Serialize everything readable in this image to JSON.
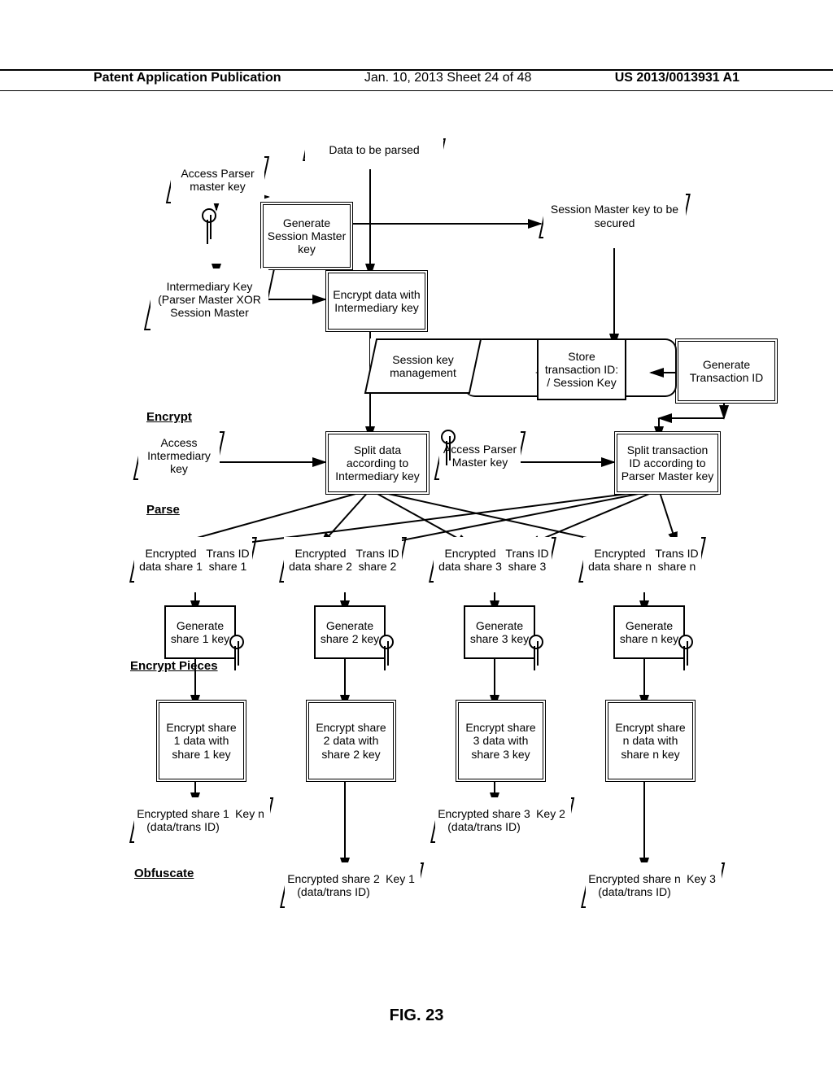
{
  "header": {
    "left": "Patent Application Publication",
    "mid": "Jan. 10, 2013  Sheet 24 of 48",
    "right": "US 2013/0013931 A1"
  },
  "figure_label": "FIG. 23",
  "sections": {
    "encrypt": "Encrypt",
    "parse": "Parse",
    "encrypt_pieces": "Encrypt Pieces",
    "obfuscate": "Obfuscate"
  },
  "nodes": {
    "data_to_be_parsed": "Data to be parsed",
    "access_parser_master_key": "Access Parser master key",
    "generate_session_master_key": "Generate Session Master key",
    "session_master_key_to_be_secured": "Session Master key to be secured",
    "intermediary_key": "Intermediary Key (Parser Master XOR Session Master",
    "encrypt_data_intermediary": "Encrypt data with Intermediary key",
    "session_key_management": "Session key management",
    "store_transaction_id_session_key": "Store transaction ID: / Session Key",
    "generate_transaction_id": "Generate Transaction ID",
    "access_intermediary_key": "Access Intermediary key",
    "split_data_intermediary": "Split data according to Intermediary key",
    "access_parser_master_key2": "Access Parser Master key",
    "split_transaction_id": "Split transaction ID according to Parser Master key",
    "enc_share1": "Encrypted data share 1",
    "trans_id1": "Trans ID share 1",
    "enc_share2": "Encrypted data share 2",
    "trans_id2": "Trans ID share 2",
    "enc_share3": "Encrypted data share 3",
    "trans_id3": "Trans ID share 3",
    "enc_sharen": "Encrypted data share n",
    "trans_idn": "Trans ID share n",
    "gen_key1": "Generate share 1 key",
    "gen_key2": "Generate share 2 key",
    "gen_key3": "Generate share 3 key",
    "gen_keyn": "Generate share n key",
    "enc_with1": "Encrypt share 1 data with share 1 key",
    "enc_with2": "Encrypt share 2 data with share 2 key",
    "enc_with3": "Encrypt share 3 data with share 3 key",
    "enc_withn": "Encrypt share n data with share n key",
    "out1": "Encrypted share 1 (data/trans ID)",
    "okey_n": "Key n",
    "out3": "Encrypted share 3 (data/trans ID)",
    "okey_2": "Key 2",
    "out2": "Encrypted share 2 (data/trans ID)",
    "okey_1": "Key 1",
    "outn": "Encrypted share n (data/trans ID)",
    "okey_3": "Key 3"
  }
}
